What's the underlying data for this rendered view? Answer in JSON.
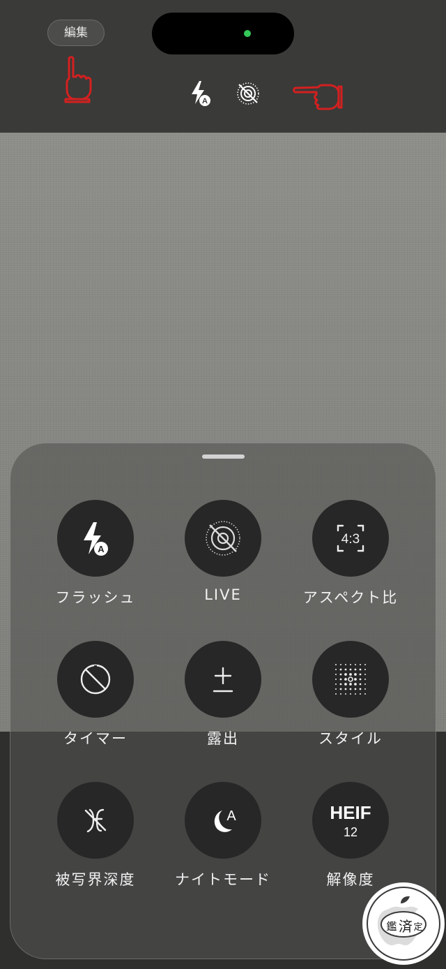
{
  "header": {
    "edit_label": "編集"
  },
  "top_controls": {
    "flash_icon": "flash-auto-icon",
    "live_icon": "live-off-icon",
    "status_dot_color": "#34c759"
  },
  "controls": [
    {
      "label": "フラッシュ",
      "icon": "flash-auto-icon"
    },
    {
      "label": "LIVE",
      "icon": "live-off-icon"
    },
    {
      "label": "アスペクト比",
      "icon": "aspect-ratio-icon",
      "icon_text": "4:3"
    },
    {
      "label": "タイマー",
      "icon": "timer-off-icon"
    },
    {
      "label": "露出",
      "icon": "exposure-icon"
    },
    {
      "label": "スタイル",
      "icon": "style-grid-icon"
    },
    {
      "label": "被写界深度",
      "icon": "depth-of-field-off-icon"
    },
    {
      "label": "ナイトモード",
      "icon": "night-mode-auto-icon",
      "icon_text": "A"
    },
    {
      "label": "解像度",
      "icon": "resolution-icon",
      "icon_text": "HEIF",
      "icon_subtext": "12"
    }
  ],
  "watermark": {
    "text_1": "鑑",
    "text_2": "済",
    "text_3": "定"
  },
  "colors": {
    "annotation_red": "#d42020",
    "tile_background": "#272727",
    "live_indicator_green": "#34c759"
  }
}
